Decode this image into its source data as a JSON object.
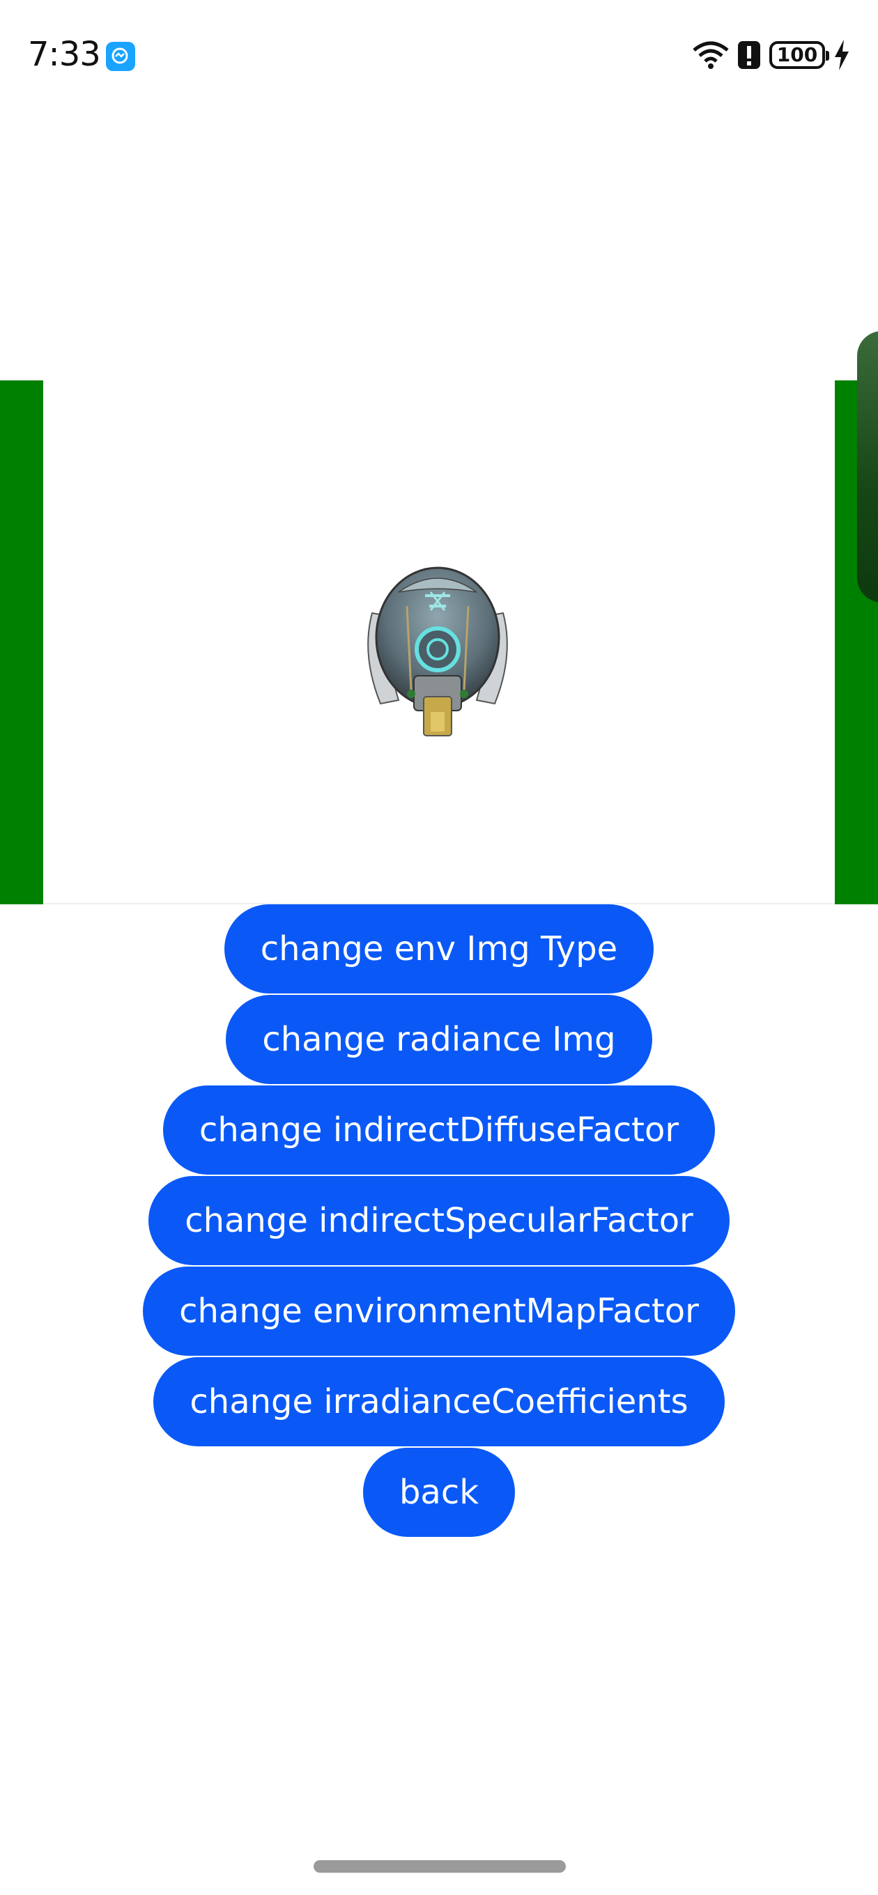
{
  "status_bar": {
    "time": "7:33",
    "battery_level": "100",
    "icons": [
      "app-notification-icon",
      "wifi-icon",
      "alert-icon",
      "battery-icon",
      "charging-icon"
    ]
  },
  "scene": {
    "model": "helmet-model",
    "side_color": "#008000",
    "background": "#ffffff"
  },
  "buttons": {
    "change_env_img_type": "change env Img Type",
    "change_radiance_img": "change radiance Img",
    "change_indirect_diffuse_factor": "change indirectDiffuseFactor",
    "change_indirect_specular_factor": "change indirectSpecularFactor",
    "change_environment_map_factor": "change environmentMapFactor",
    "change_irradiance_coefficients": "change irradianceCoefficients",
    "back": "back"
  },
  "colors": {
    "accent": "#0a59f7",
    "button_text": "#ffffff"
  }
}
